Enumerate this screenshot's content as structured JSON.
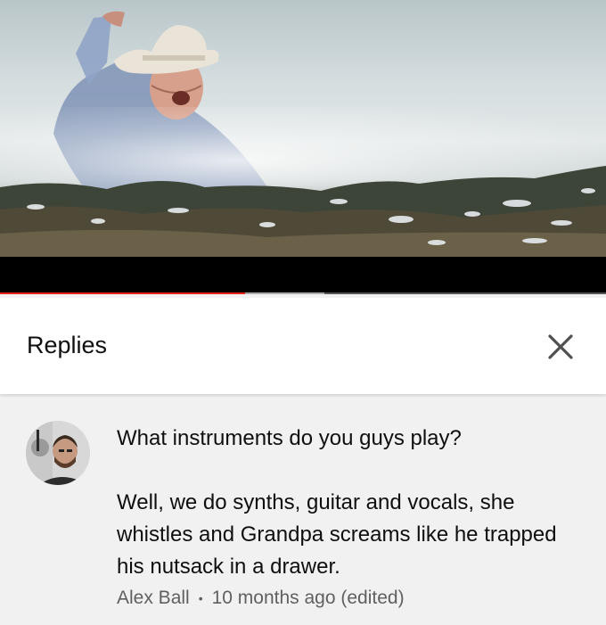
{
  "video": {
    "progress_played_fraction": 0.405,
    "progress_buffered_fraction": 0.535
  },
  "replies": {
    "title": "Replies",
    "close_icon": "close-icon"
  },
  "comment": {
    "text": "What instruments do you guys play?\n\nWell, we do synths, guitar and vocals, she whistles and Grandpa screams like he trapped his nutsack in a drawer.",
    "author": "Alex Ball",
    "separator": "•",
    "time": "10 months ago (edited)"
  },
  "colors": {
    "progress_red": "#e62117",
    "text_primary": "#0f0f0f",
    "text_secondary": "#606060"
  }
}
